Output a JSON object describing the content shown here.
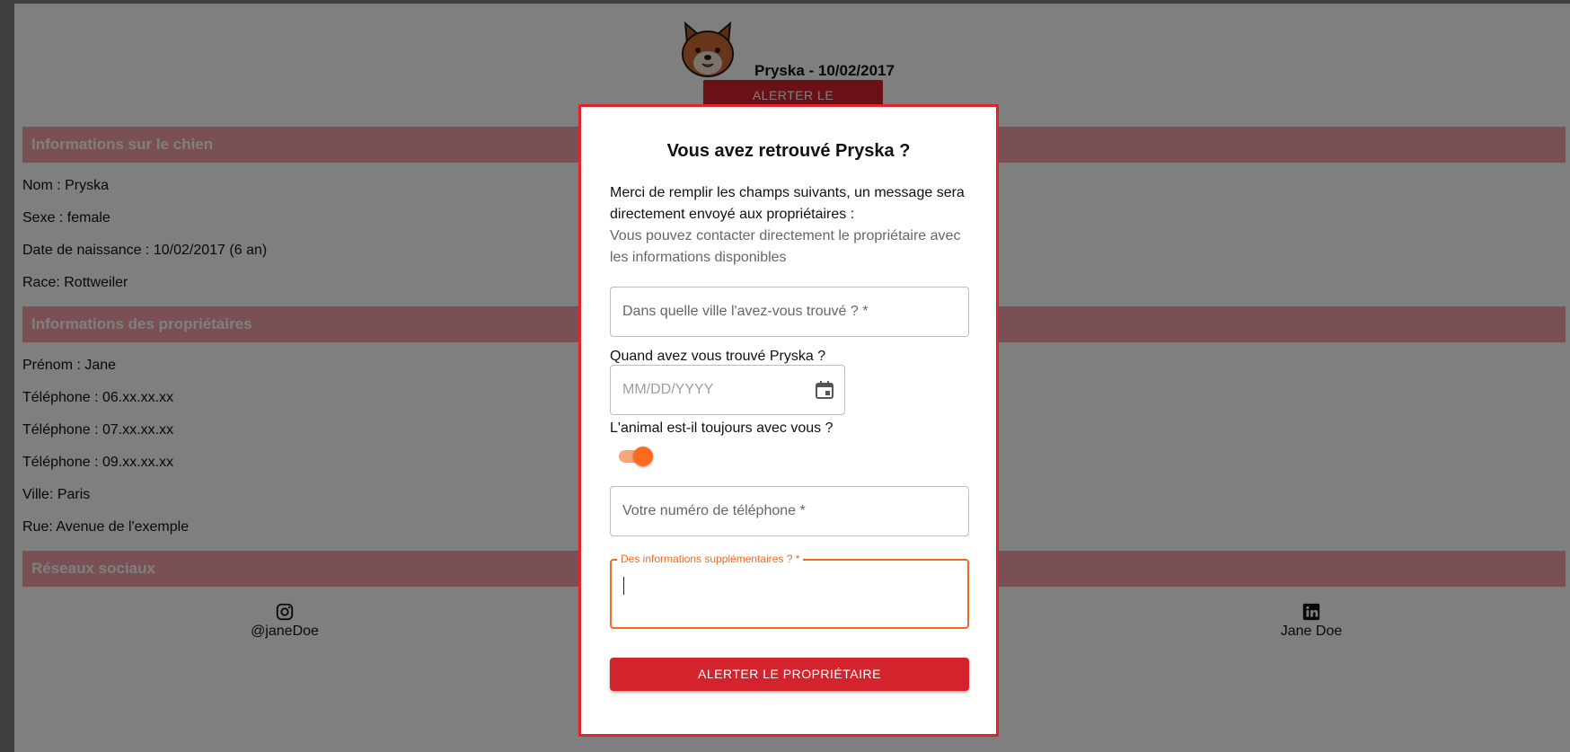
{
  "header": {
    "title": "Pryska - 10/02/2017",
    "alert_button": "ALERTER LE PROPRIÉTAIRE"
  },
  "sections": {
    "dog_info": "Informations sur le chien",
    "owners_info": "Informations des propriétaires",
    "social": "Réseaux sociaux"
  },
  "dog": {
    "name": "Nom : Pryska",
    "sex": "Sexe : female",
    "birth": "Date de naissance : 10/02/2017 (6 an)",
    "breed": "Race: Rottweiler"
  },
  "owner": {
    "firstname": "Prénom : Jane",
    "phone1": "Téléphone : 06.xx.xx.xx",
    "phone2": "Téléphone : 07.xx.xx.xx",
    "phone3": "Téléphone : 09.xx.xx.xx",
    "city": "Ville: Paris",
    "street": "Rue: Avenue de l'exemple"
  },
  "social": {
    "instagram": "@janeDoe",
    "linkedin": "Jane Doe"
  },
  "modal": {
    "title": "Vous avez retrouvé Pryska ?",
    "intro": "Merci de remplir les champs suivants, un message sera directement envoyé aux propriétaires :",
    "hint": "Vous pouvez contacter directement le propriétaire avec les informations disponibles",
    "city_placeholder": "Dans quelle ville l'avez-vous trouvé ? *",
    "date_label": "Quand avez vous trouvé Pryska ?",
    "date_placeholder": "MM/DD/YYYY",
    "with_you_label": "L'animal est-il toujours avec vous ?",
    "with_you_checked": true,
    "phone_placeholder": "Votre numéro de téléphone *",
    "extra_label": "Des informations supplémentaires ? *",
    "extra_value": "",
    "submit": "ALERTER LE PROPRIÉTAIRE"
  },
  "colors": {
    "accent_red": "#d3232d",
    "modal_border": "#e0242e",
    "focus_orange": "#f26a21",
    "section_pink": "#f2a3a8"
  }
}
